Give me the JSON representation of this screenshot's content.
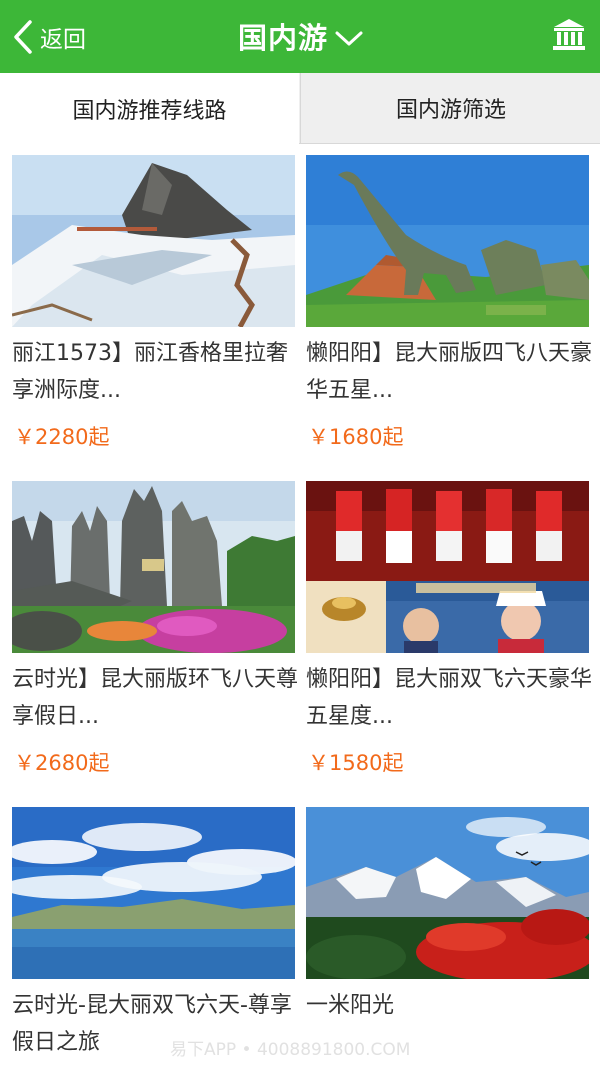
{
  "header": {
    "back_label": "返回",
    "title": "国内游",
    "bg_color": "#3db738"
  },
  "tabs": [
    {
      "label": "国内游推荐线路",
      "active": true
    },
    {
      "label": "国内游筛选",
      "active": false
    }
  ],
  "products": [
    {
      "name": "丽江1573】丽江香格里拉奢享洲际度...",
      "price": "￥2280起",
      "image": "snow-mountain-scene"
    },
    {
      "name": "懒阳阳】昆大丽版四飞八天豪华五星...",
      "price": "￥1680起",
      "image": "dinosaur-park-scene"
    },
    {
      "name": "云时光】昆大丽版环飞八天尊享假日...",
      "price": "￥2680起",
      "image": "stone-forest-scene"
    },
    {
      "name": "懒阳阳】昆大丽双飞六天豪华五星度...",
      "price": "￥1580起",
      "image": "bai-dance-scene"
    },
    {
      "name": "云时光-昆大丽双飞六天-尊享假日之旅",
      "price": "",
      "image": "lake-sky-scene"
    },
    {
      "name": "一米阳光",
      "price": "",
      "image": "snow-peak-red-leaves-scene"
    }
  ],
  "watermark": "易下APP • 4008891800.COM",
  "price_color": "#f26a1b"
}
